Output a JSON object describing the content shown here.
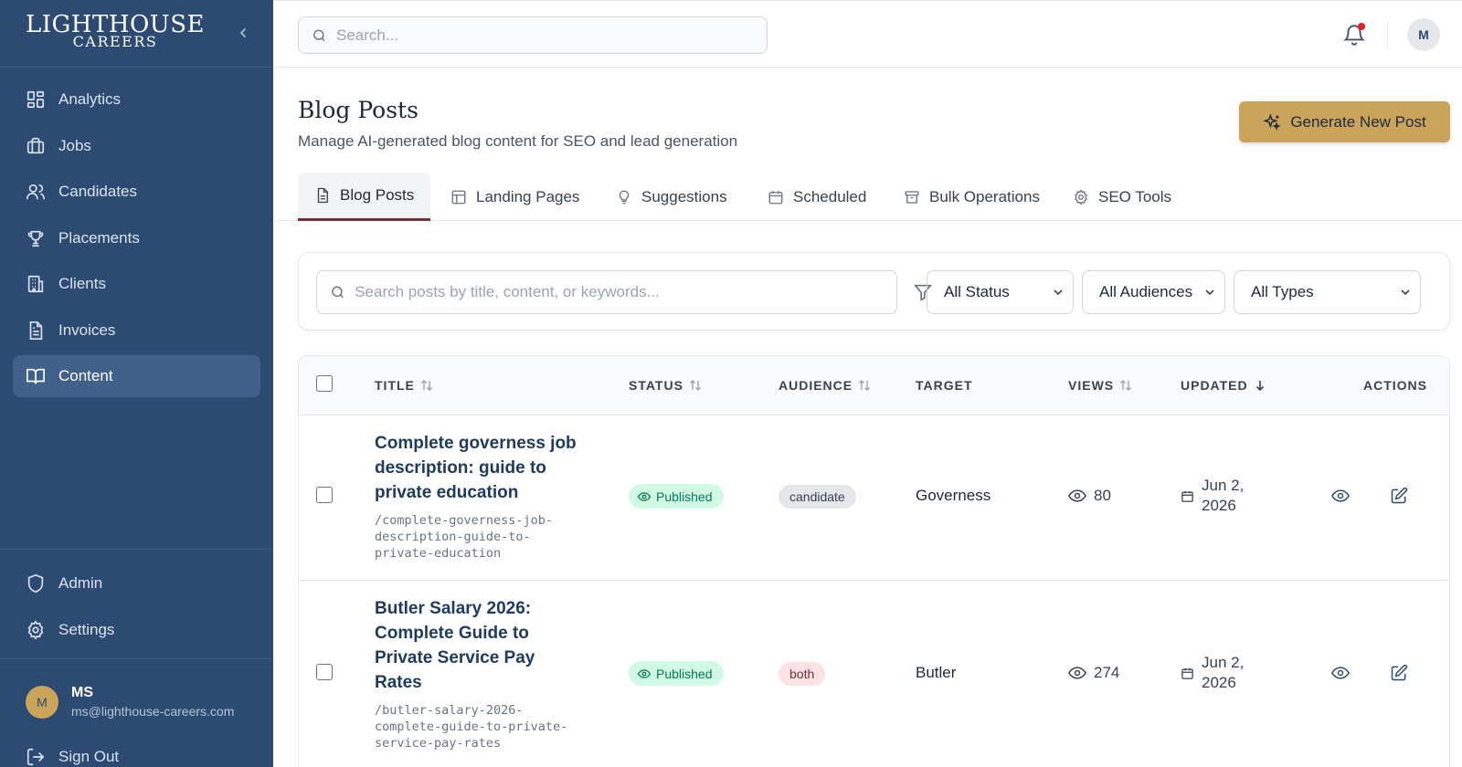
{
  "sidebar": {
    "logo": {
      "main": "LIGHTHOUSE",
      "sub": "CAREERS"
    },
    "nav": [
      {
        "label": "Analytics",
        "icon": "dashboard-icon"
      },
      {
        "label": "Jobs",
        "icon": "briefcase-icon"
      },
      {
        "label": "Candidates",
        "icon": "users-icon"
      },
      {
        "label": "Placements",
        "icon": "trophy-icon"
      },
      {
        "label": "Clients",
        "icon": "building-icon"
      },
      {
        "label": "Invoices",
        "icon": "file-text-icon"
      },
      {
        "label": "Content",
        "icon": "book-open-icon",
        "active": true
      }
    ],
    "bottom_nav": [
      {
        "label": "Admin",
        "icon": "shield-icon"
      },
      {
        "label": "Settings",
        "icon": "gear-icon"
      }
    ],
    "user": {
      "initial": "M",
      "name": "MS",
      "email": "ms@lighthouse-careers.com"
    },
    "sign_out": "Sign Out"
  },
  "topbar": {
    "search_placeholder": "Search...",
    "avatar_initial": "M"
  },
  "page": {
    "title": "Blog Posts",
    "subtitle": "Manage AI-generated blog content for SEO and lead generation",
    "generate_button": "Generate New Post"
  },
  "tabs": [
    {
      "label": "Blog Posts",
      "active": true
    },
    {
      "label": "Landing Pages"
    },
    {
      "label": "Suggestions"
    },
    {
      "label": "Scheduled"
    },
    {
      "label": "Bulk Operations"
    },
    {
      "label": "SEO Tools"
    }
  ],
  "filters": {
    "search_placeholder": "Search posts by title, content, or keywords...",
    "status": "All Status",
    "audience": "All Audiences",
    "type": "All Types"
  },
  "table": {
    "headers": {
      "title": "TITLE",
      "status": "STATUS",
      "audience": "AUDIENCE",
      "target": "TARGET",
      "views": "VIEWS",
      "updated": "UPDATED",
      "actions": "ACTIONS"
    },
    "rows": [
      {
        "title": "Complete governess job description: guide to private education",
        "slug": "/complete-governess-job-description-guide-to-private-education",
        "status": "Published",
        "audience": "candidate",
        "target": "Governess",
        "views": "80",
        "updated": "Jun 2, 2026"
      },
      {
        "title": "Butler Salary 2026: Complete Guide to Private Service Pay Rates",
        "slug": "/butler-salary-2026-complete-guide-to-private-service-pay-rates",
        "status": "Published",
        "audience": "both",
        "target": "Butler",
        "views": "274",
        "updated": "Jun 2, 2026"
      }
    ]
  },
  "colors": {
    "sidebar_bg": "#2c4a72",
    "accent_gold": "#c9a45a",
    "tab_underline": "#7a2e33",
    "published_bg": "#d1fae5",
    "published_text": "#047857"
  }
}
